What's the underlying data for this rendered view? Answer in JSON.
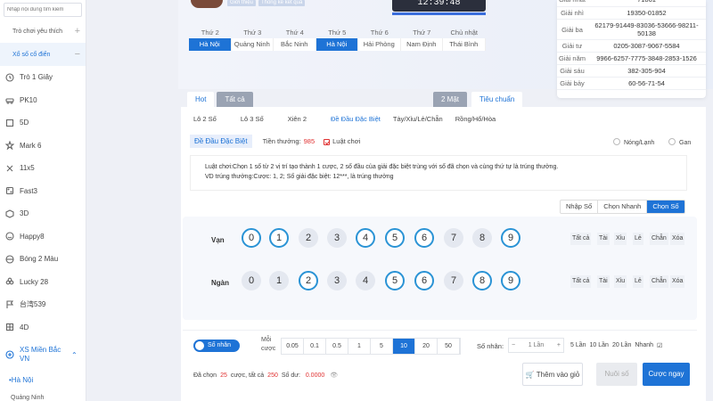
{
  "sidebar": {
    "search_placeholder": "Nhập nội dung tìm kiếm",
    "favorites": "Trò chơi yêu thích",
    "traditional": "Xổ số cổ điển",
    "items": [
      {
        "label": "Trò 1 Giây",
        "icon": "clock-icon"
      },
      {
        "label": "PK10",
        "icon": "car-icon"
      },
      {
        "label": "5D",
        "icon": "box-icon"
      },
      {
        "label": "Mark 6",
        "icon": "star-icon"
      },
      {
        "label": "11x5",
        "icon": "cross-icon"
      },
      {
        "label": "Fast3",
        "icon": "dice-icon"
      },
      {
        "label": "3D",
        "icon": "cube-icon"
      },
      {
        "label": "Happy8",
        "icon": "smile-icon"
      },
      {
        "label": "Bóng 2 Màu",
        "icon": "ball-icon"
      },
      {
        "label": "Lucky 28",
        "icon": "clover-icon"
      },
      {
        "label": "台湾539",
        "icon": "flag-icon"
      },
      {
        "label": "4D",
        "icon": "grid-icon"
      }
    ],
    "vn_group": "XS Miền Bắc VN",
    "vn_sub_selected": "•Hà Nội",
    "vn_sub_next": "Quảng Ninh"
  },
  "header": {
    "chip_intro": "Giới thiệu",
    "chip_stats": "Thống kê kết quả",
    "clock": "12:39:48"
  },
  "days": [
    {
      "day": "Thứ 2",
      "city": "Hà Nội",
      "selected": true
    },
    {
      "day": "Thứ 3",
      "city": "Quảng Ninh",
      "selected": false
    },
    {
      "day": "Thứ 4",
      "city": "Bắc Ninh",
      "selected": false
    },
    {
      "day": "Thứ 5",
      "city": "Hà Nội",
      "selected": true
    },
    {
      "day": "Thứ 6",
      "city": "Hải Phòng",
      "selected": false
    },
    {
      "day": "Thứ 7",
      "city": "Nam Định",
      "selected": false
    },
    {
      "day": "Chủ nhật",
      "city": "Thái Bình",
      "selected": false
    }
  ],
  "results": [
    {
      "label": "Giải nhất",
      "value": "71861"
    },
    {
      "label": "Giải nhì",
      "value": "19350-01852"
    },
    {
      "label": "Giải ba",
      "value": "62179-91449-83036-53666-98211-50138"
    },
    {
      "label": "Giải tư",
      "value": "0205-3087-9067-5584"
    },
    {
      "label": "Giải năm",
      "value": "9966-6257-7775-3848-2853-1526"
    },
    {
      "label": "Giải sáu",
      "value": "382-305-904"
    },
    {
      "label": "Giải bảy",
      "value": "60-56-71-54"
    }
  ],
  "tabs": {
    "hot": "Hot",
    "all": "Tất cả",
    "two_sides": "2 Mặt",
    "standard": "Tiêu chuẩn"
  },
  "subtabs": [
    "Lô 2 Số",
    "Lô 3 Số",
    "Xiên 2",
    "Đề Đầu Đặc Biệt",
    "Tày/Xỉu/Lẻ/Chẵn",
    "Rồng/Hổ/Hòa"
  ],
  "info": {
    "game": "Đề Đầu Đặc Biệt",
    "bonus_label": "Tiền thưởng:",
    "bonus_value": "985",
    "rules_label": "Luật chơi",
    "radio1": "Nóng/Lạnh",
    "radio2": "Gan"
  },
  "rules": {
    "line1": "Luật chơi:Chọn 1 số từ 2 vị trí tạo thành 1 cược, 2 số đầu của giải đặc biệt trùng với số đã chọn và cùng thứ tự là trúng thưởng.",
    "line2": "VD trúng thưởng:Cược: 1, 2; Số giải đặc biệt: 12***, là trúng thưởng"
  },
  "modes": {
    "manual": "Nhập Số",
    "quick": "Chọn Nhanh",
    "pick": "Chọn Số"
  },
  "rows": [
    {
      "label": "Vạn",
      "selected": [
        0,
        1,
        4,
        5,
        6,
        9
      ]
    },
    {
      "label": "Ngàn",
      "selected": [
        2,
        5,
        6,
        8,
        9
      ]
    }
  ],
  "digits": [
    "0",
    "1",
    "2",
    "3",
    "4",
    "5",
    "6",
    "7",
    "8",
    "9"
  ],
  "quick": [
    "Tất cả",
    "Tài",
    "Xỉu",
    "Lẻ",
    "Chẵn",
    "Xóa"
  ],
  "bottom": {
    "toggle": "Số nhân",
    "unit_label": "Mỗi cược",
    "amounts": [
      "0.05",
      "0.1",
      "0.5",
      "1",
      "5",
      "10",
      "20",
      "50"
    ],
    "selected_amount": "10",
    "mult_label": "Số nhân:",
    "mult_value": "1 Lần",
    "mult_opts": [
      "5 Lần",
      "10 Lần",
      "20 Lần",
      "Nhanh"
    ],
    "selected_prefix": "Đã chọn",
    "selected_count": "25",
    "bets_label": "cược, tất cả",
    "total": "250",
    "balance_label": "Số dư:",
    "balance": "0.0000",
    "add_btn": "Thêm vào giỏ",
    "chase_btn": "Nuôi số",
    "bet_btn": "Cược ngay"
  }
}
